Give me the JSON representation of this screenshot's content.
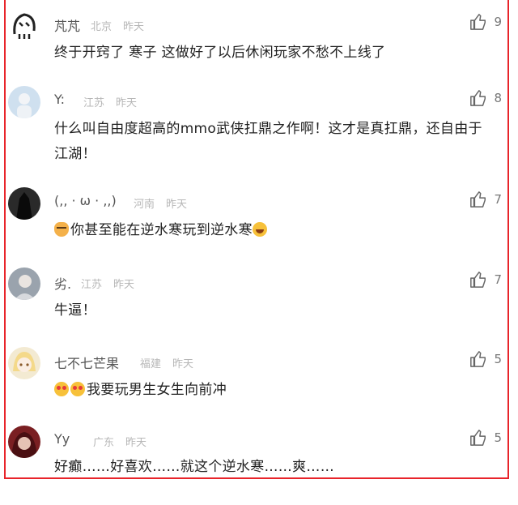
{
  "comments": [
    {
      "name": "芃芃",
      "location": "北京",
      "time": "昨天",
      "likes": "9",
      "text": "终于开窍了 寒子 这做好了以后休闲玩家不愁不上线了"
    },
    {
      "name": "Y:",
      "location": "江苏",
      "time": "昨天",
      "likes": "8",
      "text": "什么叫自由度超高的mmo武侠扛鼎之作啊！这才是真扛鼎，还自由于江湖！"
    },
    {
      "name": "(,, · ω · ,,)",
      "location": "河南",
      "time": "昨天",
      "likes": "7",
      "text": "你甚至能在逆水寒玩到逆水寒"
    },
    {
      "name": "劣.",
      "location": "江苏",
      "time": "昨天",
      "likes": "7",
      "text": "牛逼！"
    },
    {
      "name": "七不七芒果",
      "location": "福建",
      "time": "昨天",
      "likes": "5",
      "text": "我要玩男生女生向前冲"
    },
    {
      "name": "Yy",
      "location": "广东",
      "time": "昨天",
      "likes": "5",
      "text": "好癫……好喜欢……就这个逆水寒……爽……"
    }
  ],
  "icons": {
    "like": "thumbs-up-icon"
  },
  "colors": {
    "frame": "#e8242a",
    "meta": "#b7b7b7"
  }
}
